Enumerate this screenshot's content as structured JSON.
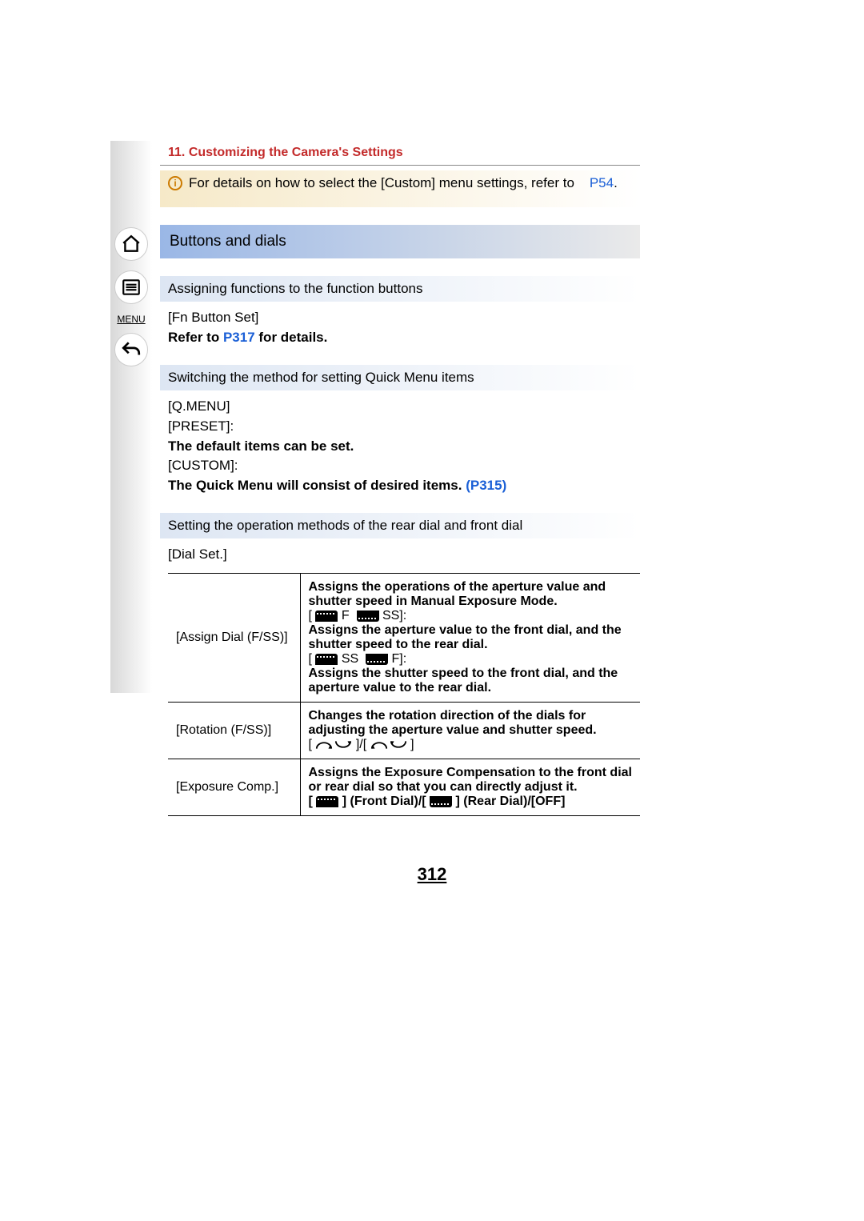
{
  "chapter": {
    "number": "11.",
    "title": "Customizing the Camera's Settings"
  },
  "info": {
    "text": "For details on how to select the [Custom] menu settings, refer to",
    "link": "P54",
    "period": "."
  },
  "section": {
    "title": "Buttons and dials"
  },
  "sidebar": {
    "menu_label": "MENU"
  },
  "sub1": {
    "heading": "Assigning functions to the function buttons",
    "item": "[Fn Button Set]",
    "refer_prefix": "Refer to ",
    "refer_link": "P317",
    "refer_suffix": " for details."
  },
  "sub2": {
    "heading": "Switching the method for setting Quick Menu items",
    "item": "[Q.MENU]",
    "preset": "[PRESET]:",
    "preset_desc": "The default items can be set.",
    "custom": "[CUSTOM]:",
    "custom_desc_prefix": "The Quick Menu will consist of desired items. ",
    "custom_link": "(P315)"
  },
  "sub3": {
    "heading": "Setting the operation methods of the rear dial and front dial",
    "item": "[Dial Set.]"
  },
  "table": {
    "rows": [
      {
        "label": "[Assign Dial (F/SS)]",
        "line1": "Assigns the operations of the aperture value and shutter speed in Manual Exposure Mode.",
        "opt1_suffix": "SS]:",
        "opt1_desc": "Assigns the aperture value to the front dial, and the shutter speed to the rear dial.",
        "opt2_suffix": "F]:",
        "opt2_desc": "Assigns the shutter speed to the front dial, and the aperture value to the rear dial."
      },
      {
        "label": "[Rotation (F/SS)]",
        "line1": "Changes the rotation direction of the dials for adjusting the aperture value and shutter speed."
      },
      {
        "label": "[Exposure Comp.]",
        "line1": "Assigns the Exposure Compensation to the front dial or rear dial so that you can directly adjust it.",
        "opt_front": "] (Front Dial)/",
        "opt_rear": "] (Rear Dial)/",
        "opt_off": "[OFF]"
      }
    ]
  },
  "page_number": "312"
}
